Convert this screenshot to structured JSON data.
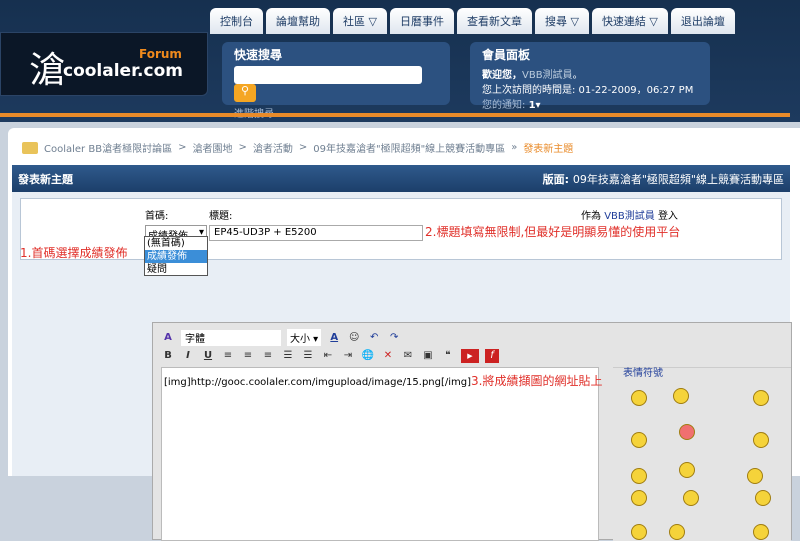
{
  "header": {
    "logo_glyph": "滄",
    "logo_forum": "Forum",
    "logo_site": "coolaler.com",
    "tabs": [
      "控制台",
      "論壇幫助",
      "社區 ▽",
      "日曆事件",
      "查看新文章",
      "搜尋 ▽",
      "快速連結 ▽",
      "退出論壇"
    ],
    "search": {
      "title": "快速搜尋",
      "advanced": "進階搜尋",
      "button_icon": "search-icon"
    },
    "member": {
      "title": "會員面板",
      "welcome_label": "歡迎您，",
      "username": "VBB測試員",
      "welcome_suffix": "。",
      "last_visit": "您上次訪問的時間是: 01-22-2009，06:27 PM",
      "notice_label": "您的通知:",
      "notice_count": "1"
    }
  },
  "breadcrumb": [
    "Coolaler BB滄者極限討論區",
    "滄者園地",
    "滄者活動",
    "09年技嘉滄者\"極限超頻\"線上競賽活動專區"
  ],
  "breadcrumb_current": "發表新主題",
  "titlebar": {
    "title": "發表新主題",
    "forum_label": "版面:",
    "forum_name": "09年技嘉滄者\"極限超頻\"線上競賽活動專區"
  },
  "form": {
    "prefix_label": "首碼:",
    "title_label": "標題:",
    "prefix_value": "成績發佈",
    "title_value": "EP45-UD3P + E5200",
    "logged_as": "作為",
    "user": "VBB測試員",
    "logged_suffix": "登入",
    "prefix_options": [
      "(無首碼)",
      "成績發佈",
      "疑問"
    ]
  },
  "annotations": [
    "1.首碼選擇成績發佈",
    "2.標題填寫無限制,但最好是明顯易懂的使用平台",
    "3.將成績擷圖的網址貼上"
  ],
  "editor": {
    "font": "字體",
    "size": "大小",
    "content": "[img]http://gooc.coolaler.com/imgupload/image/15.png[/img]",
    "smilies_title": "表情符號"
  }
}
